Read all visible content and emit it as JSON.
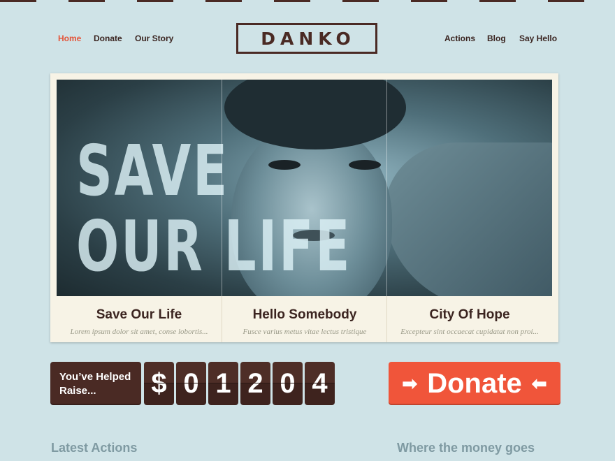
{
  "nav": {
    "left": [
      "Home",
      "Donate",
      "Our Story"
    ],
    "right": [
      "Actions",
      "Blog",
      "Say Hello"
    ],
    "active": "Home"
  },
  "logo": "DANKO",
  "hero": {
    "overlay_line1": "SAVE",
    "overlay_line2": "OUR LIFE",
    "slides": [
      {
        "title": "Save Our Life",
        "subtitle": "Lorem ipsum dolor sit amet, conse lobortis..."
      },
      {
        "title": "Hello Somebody",
        "subtitle": "Fusce varius metus vitae lectus tristique"
      },
      {
        "title": "City Of Hope",
        "subtitle": "Excepteur sint occaecat cupidatat non proi..."
      }
    ]
  },
  "counter": {
    "label_line1": "You’ve Helped",
    "label_line2": "Raise...",
    "digits": [
      "$",
      "0",
      "1",
      "2",
      "0",
      "4"
    ]
  },
  "donate_button": {
    "label": "Donate",
    "left_arrow": "➡",
    "right_arrow": "⬅"
  },
  "sections": {
    "latest_actions": "Latest Actions",
    "money": "Where the money goes"
  },
  "colors": {
    "accent": "#f0553a",
    "brand_dark": "#4a2a24",
    "background": "#cfe3e7"
  }
}
